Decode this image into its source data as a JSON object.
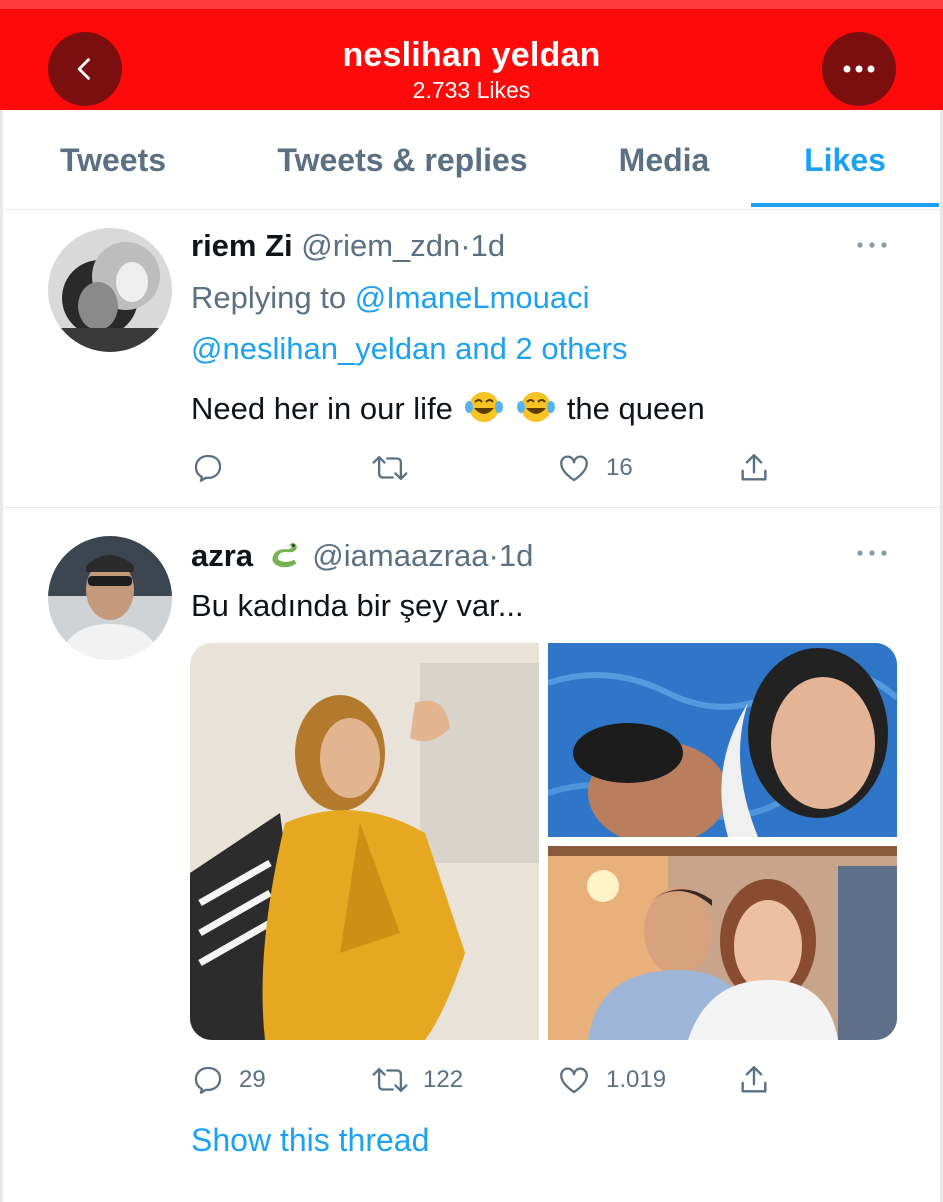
{
  "header": {
    "title": "neslihan yeldan",
    "subtitle": "2.733 Likes",
    "back_icon": "chevron-left-icon",
    "more_icon": "more-icon"
  },
  "tabs": [
    {
      "label": "Tweets",
      "active": false
    },
    {
      "label": "Tweets & replies",
      "active": false
    },
    {
      "label": "Media",
      "active": false
    },
    {
      "label": "Likes",
      "active": true
    }
  ],
  "colors": {
    "header_bg": "#ff0a0a",
    "header_button_bg": "#7b0f10",
    "accent": "#1da1f2",
    "secondary_text": "#5b7083"
  },
  "tweets": [
    {
      "name": "riem Zi",
      "handle": "@riem_zdn",
      "separator": "·",
      "time": "1d",
      "replying_prefix": "Replying to",
      "replying_to_1": "@ImaneLmouaci",
      "replying_to_2": "@neslihan_yeldan and 2 others",
      "text_before": "Need her in our life",
      "emojis": [
        "face-with-tears-of-joy",
        "face-with-tears-of-joy"
      ],
      "text_after": "the queen",
      "reply_count": "",
      "retweet_count": "",
      "like_count": "16"
    },
    {
      "name": "azra",
      "name_emoji": "snake",
      "handle": "@iamaazraa",
      "separator": "·",
      "time": "1d",
      "text": "Bu kadında bir şey var...",
      "media_count": 3,
      "reply_count": "29",
      "retweet_count": "122",
      "like_count": "1.019",
      "show_thread": "Show this thread"
    }
  ]
}
